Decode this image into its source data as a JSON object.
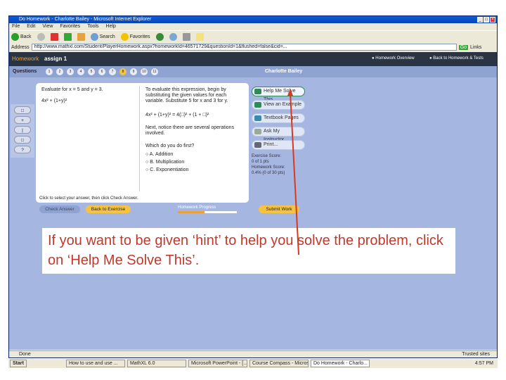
{
  "window": {
    "title": "Do Homework - Charlotte Bailey - Microsoft Internet Explorer",
    "min": "_",
    "max": "□",
    "close": "×"
  },
  "menu": [
    "File",
    "Edit",
    "View",
    "Favorites",
    "Tools",
    "Help"
  ],
  "toolbar": {
    "back": "Back",
    "search": "Search",
    "favorites": "Favorites"
  },
  "address": {
    "label": "Address",
    "url": "http://www.mathxl.com/Student/PlayerHomework.aspx?homeworkId=46571729&questionId=1&flushed=false&cid=...",
    "go": "Go",
    "links": "Links"
  },
  "app": {
    "section": "Homework",
    "assignment": "assign 1",
    "nav_overview": "Homework Overview",
    "nav_back": "Back to Homework & Tests"
  },
  "questions": {
    "label": "Questions",
    "items": [
      "1",
      "2",
      "3",
      "4",
      "5",
      "6",
      "7",
      "8",
      "9",
      "10",
      "11"
    ],
    "current": "8",
    "student": "Charlotte Bailey"
  },
  "problem": {
    "prompt": "Evaluate for x = 5 and y = 3.",
    "expression": "4x² + (1+y)²"
  },
  "help": {
    "intro": "To evaluate this expression, begin by substituting the given values for each variable. Substitute 5 for x and 3 for y.",
    "substitution": "4x² + (1+y)² = 4(□)² + (1 + □)²",
    "next": "Next, notice there are several operations involved.",
    "question": "Which do you do first?",
    "options": [
      "A. Addition",
      "B. Multiplication",
      "C. Exponentiation"
    ],
    "footer": "Click to select your answer, then click Check Answer."
  },
  "side": {
    "buttons": [
      "Help Me Solve This",
      "View an Example",
      "Textbook Pages",
      "Ask My Instructor...",
      "Print..."
    ],
    "exercise_score_label": "Exercise Score:",
    "exercise_score": "0 of 1 pts",
    "homework_score_label": "Homework Score:",
    "homework_score": "0.4% (0 of 30 pts)"
  },
  "bottom": {
    "check": "Check Answer",
    "back": "Back to Exercise",
    "progress_label": "Homework Progress",
    "progress": 0.45,
    "submit": "Submit Work"
  },
  "tools": [
    "□",
    "+",
    "|",
    "□",
    "?"
  ],
  "callout": "If you want to be given ‘hint’ to help you solve the problem, click on ‘Help Me Solve This’.",
  "status": {
    "text": "Done",
    "zone": "Trusted sites"
  },
  "taskbar": {
    "start": "Start",
    "tasks": [
      "How to use and use ...",
      "MathXL 6.0",
      "Microsoft PowerPoint - [...]",
      "Course Compass - Micros...",
      "Do Homework - Charlo..."
    ],
    "clock": "4:57 PM"
  }
}
